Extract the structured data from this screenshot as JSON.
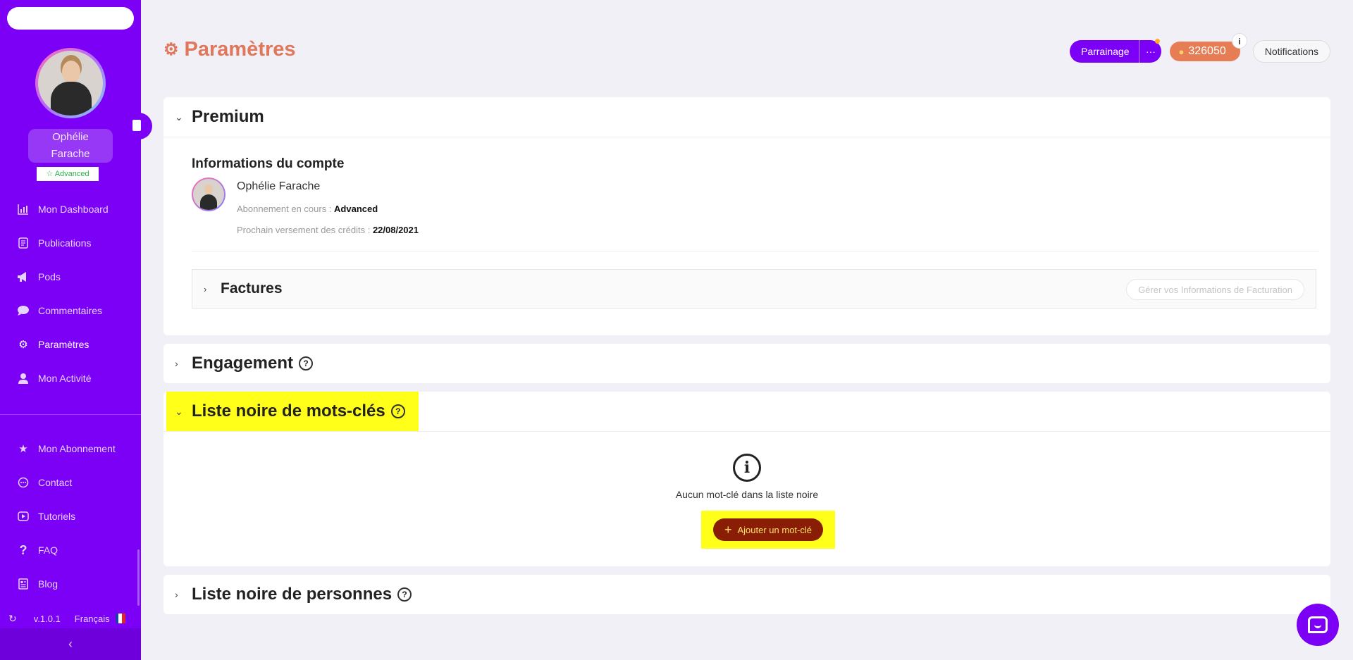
{
  "sidebar": {
    "user": {
      "name_line1": "Ophélie",
      "name_line2": "Farache",
      "plan_badge": "Advanced"
    },
    "nav": [
      {
        "label": "Mon Dashboard",
        "icon": "bar-chart-icon"
      },
      {
        "label": "Publications",
        "icon": "document-icon"
      },
      {
        "label": "Pods",
        "icon": "megaphone-icon"
      },
      {
        "label": "Commentaires",
        "icon": "chat-bubble-icon"
      },
      {
        "label": "Paramètres",
        "icon": "gear-icon",
        "active": true
      },
      {
        "label": "Mon Activité",
        "icon": "user-icon"
      }
    ],
    "nav_bottom": [
      {
        "label": "Mon Abonnement",
        "icon": "star-icon"
      },
      {
        "label": "Contact",
        "icon": "message-icon"
      },
      {
        "label": "Tutoriels",
        "icon": "play-icon"
      },
      {
        "label": "FAQ",
        "icon": "question-icon"
      },
      {
        "label": "Blog",
        "icon": "newspaper-icon"
      }
    ],
    "footer": {
      "version": "v.1.0.1",
      "language": "Français"
    },
    "colors": {
      "background": "#7b00f5"
    }
  },
  "header": {
    "title": "Paramètres",
    "parrainage_label": "Parrainage",
    "more_label": "···",
    "credits_value": "326050",
    "credits_info": "i",
    "notifications_label": "Notifications"
  },
  "premium": {
    "title": "Premium",
    "account_title": "Informations du compte",
    "account_name": "Ophélie Farache",
    "subscription_label": "Abonnement en cours :",
    "subscription_value": "Advanced",
    "next_credits_label": "Prochain versement des crédits :",
    "next_credits_value": "22/08/2021",
    "factures_title": "Factures",
    "billing_button": "Gérer vos Informations de Facturation"
  },
  "engagement": {
    "title": "Engagement",
    "help": "?"
  },
  "blacklist_keywords": {
    "title": "Liste noire de mots-clés",
    "help": "?",
    "empty_icon": "i",
    "empty_text": "Aucun mot-clé dans la liste noire",
    "add_button": "Ajouter un mot-clé",
    "add_plus": "+"
  },
  "blacklist_people": {
    "title": "Liste noire de personnes",
    "help": "?"
  },
  "colors": {
    "accent": "#7b00f5",
    "title": "#e0775b",
    "credits": "#e77d55",
    "add_button": "#8a1d06",
    "highlight": "#ffff1a"
  }
}
